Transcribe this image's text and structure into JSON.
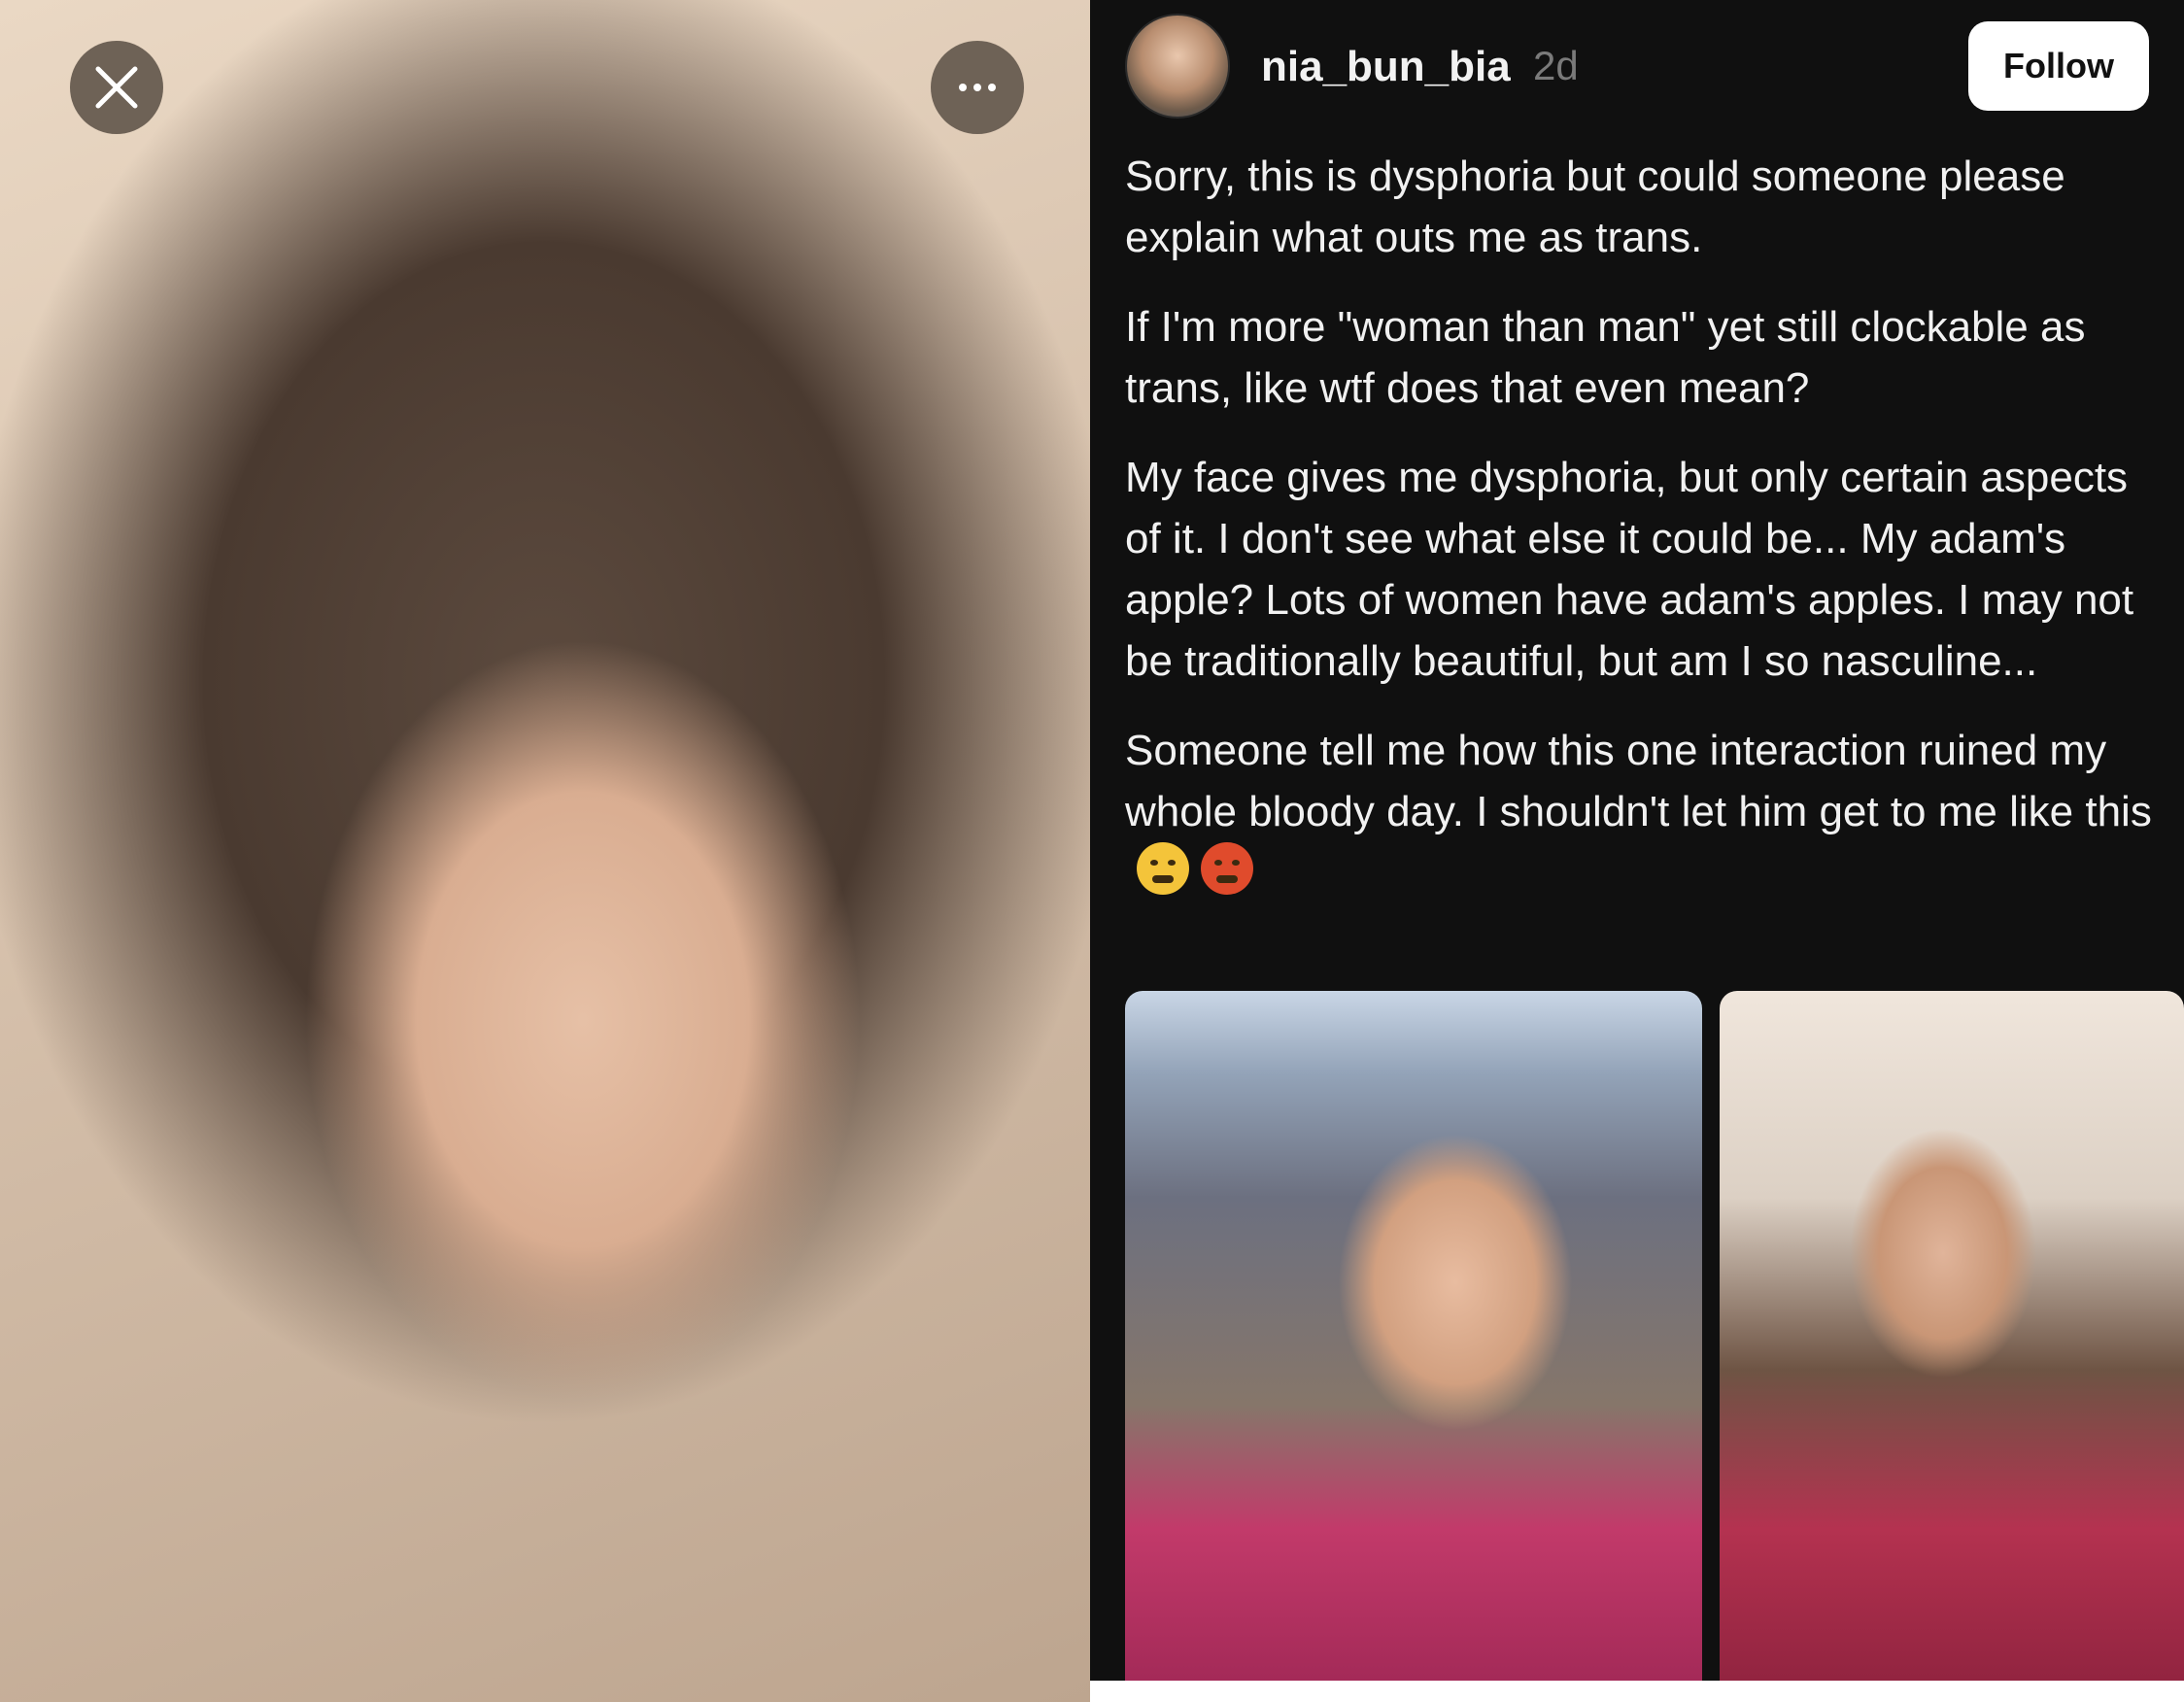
{
  "viewer": {
    "close_icon": "close-icon",
    "more_icon": "more-options-icon"
  },
  "post": {
    "username": "nia_bun_bia",
    "timestamp": "2d",
    "follow_label": "Follow",
    "paragraphs": [
      "Sorry, this is dysphoria but could someone please explain what outs me as trans.",
      "If I'm more \"woman than man\" yet still clockable as trans, like wtf does that even mean?",
      "My face gives me dysphoria, but only certain aspects of it. I don't see what else it could be... My adam's apple? Lots of women have adam's apples. I may not be traditionally beautiful, but am I so nasculine...",
      "Someone tell me how this one interaction ruined my whole bloody day. I shouldn't let him get to me like this"
    ],
    "emojis": [
      "face-exhaling-emoji",
      "face-with-symbols-on-mouth-emoji"
    ]
  },
  "colors": {
    "panel_bg": "#101010",
    "text": "#f1f1f1",
    "muted": "#7a7a7a",
    "button_bg": "#ffffff"
  }
}
